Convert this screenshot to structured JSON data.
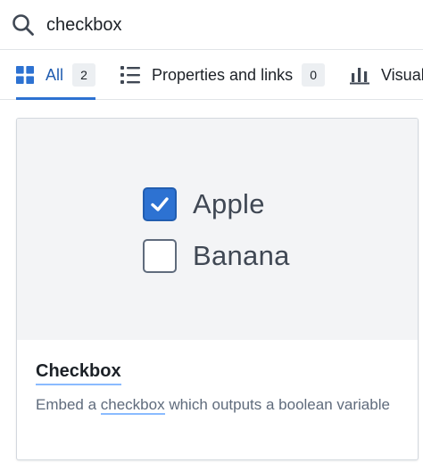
{
  "search": {
    "value": "checkbox",
    "icon": "search-icon"
  },
  "tabs": [
    {
      "label": "All",
      "count": "2",
      "icon": "grid-icon",
      "active": true
    },
    {
      "label": "Properties and links",
      "count": "0",
      "icon": "list-icon",
      "active": false
    },
    {
      "label": "Visual",
      "icon": "bar-chart-icon",
      "active": false
    }
  ],
  "result": {
    "preview": {
      "options": [
        {
          "label": "Apple",
          "checked": true
        },
        {
          "label": "Banana",
          "checked": false
        }
      ]
    },
    "title": "Checkbox",
    "description_prefix": "Embed a ",
    "description_highlight": "checkbox",
    "description_suffix": " which outputs a boolean variable"
  },
  "colors": {
    "accent": "#2d72d2",
    "active_text": "#215db0",
    "preview_bg": "#f3f4f6",
    "highlight_underline": "#8abbff"
  }
}
